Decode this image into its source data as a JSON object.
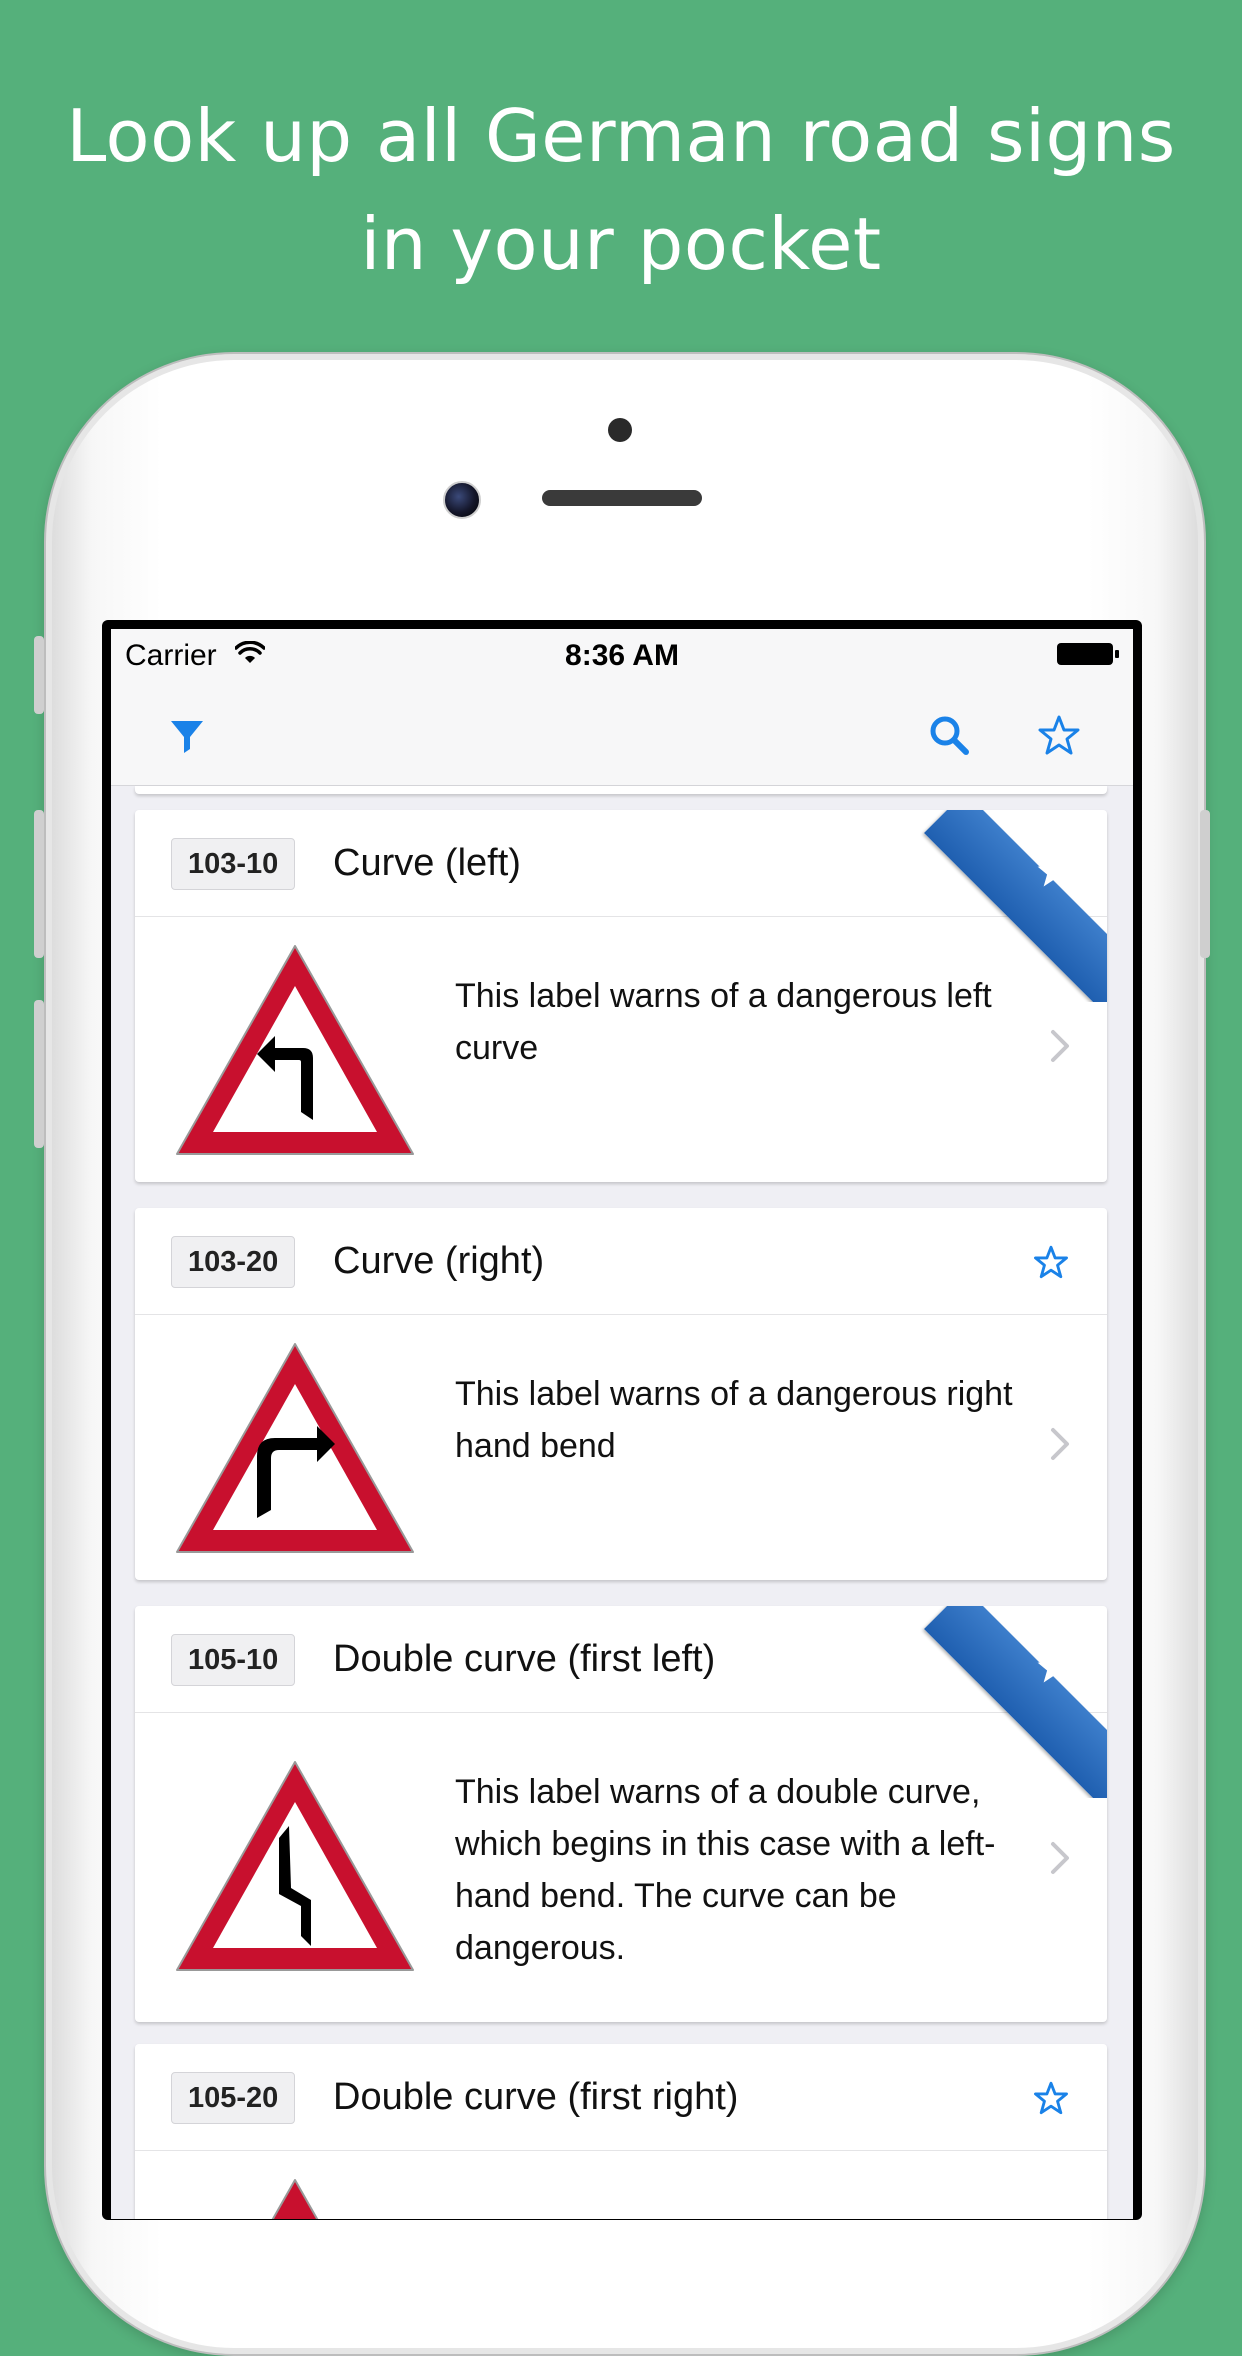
{
  "headline": {
    "line1": "Look up all German road signs",
    "line2": "in your pocket"
  },
  "status_bar": {
    "carrier": "Carrier",
    "time": "8:36 AM"
  },
  "toolbar": {
    "filter_icon": "filter-icon",
    "search_icon": "search-icon",
    "favorites_icon": "star-outline-icon"
  },
  "colors": {
    "background": "#55b07b",
    "accent": "#1a82e8",
    "sign_red": "#c8102e",
    "ribbon_blue": "#2a6dbd"
  },
  "signs": [
    {
      "code": "103-10",
      "title": "Curve (left)",
      "description": "This label warns of a dangerous left curve",
      "favorite": true,
      "symbol": "curve-left"
    },
    {
      "code": "103-20",
      "title": "Curve (right)",
      "description": "This label warns of a dangerous right hand bend",
      "favorite": false,
      "symbol": "curve-right"
    },
    {
      "code": "105-10",
      "title": "Double curve (first left)",
      "description": "This label warns of a double curve, which begins in this case with a left-hand bend. The curve can be dangerous.",
      "favorite": true,
      "symbol": "double-curve-left"
    },
    {
      "code": "105-20",
      "title": "Double curve (first right)",
      "description": "",
      "favorite": false,
      "symbol": "double-curve-right"
    }
  ]
}
